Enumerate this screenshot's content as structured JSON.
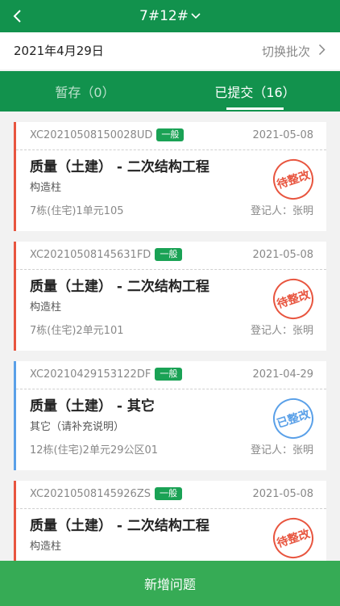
{
  "header": {
    "title": "7#12#",
    "back_icon": "chevron-left-icon",
    "dropdown_icon": "chevron-down-icon"
  },
  "date_bar": {
    "date": "2021年4月29日",
    "switch_label": "切换批次",
    "switch_icon": "chevron-right-icon"
  },
  "tabs": [
    {
      "label": "暂存（0）",
      "active": false
    },
    {
      "label": "已提交（16）",
      "active": true
    }
  ],
  "cards": [
    {
      "code": "XC20210508150028UD",
      "badge": "一般",
      "date": "2021-05-08",
      "title": "质量（土建） - 二次结构工程",
      "subtitle": "构造柱",
      "location": "7栋(住宅)1单元105",
      "registrar": "登记人：张明",
      "stamp": "待整改",
      "status_color": "#e8553f"
    },
    {
      "code": "XC20210508145631FD",
      "badge": "一般",
      "date": "2021-05-08",
      "title": "质量（土建） - 二次结构工程",
      "subtitle": "构造柱",
      "location": "7栋(住宅)2单元101",
      "registrar": "登记人：张明",
      "stamp": "待整改",
      "status_color": "#e8553f"
    },
    {
      "code": "XC20210429153122DF",
      "badge": "一般",
      "date": "2021-04-29",
      "title": "质量（土建） - 其它",
      "subtitle": "其它（请补充说明）",
      "location": "12栋(住宅)2单元29公区01",
      "registrar": "登记人：张明",
      "stamp": "已整改",
      "status_color": "#5aa0e8"
    },
    {
      "code": "XC20210508145926ZS",
      "badge": "一般",
      "date": "2021-05-08",
      "title": "质量（土建） - 二次结构工程",
      "subtitle": "构造柱",
      "location": "",
      "registrar": "",
      "stamp": "待整改",
      "status_color": "#e8553f"
    }
  ],
  "bottom_button": {
    "label": "新增问题"
  }
}
